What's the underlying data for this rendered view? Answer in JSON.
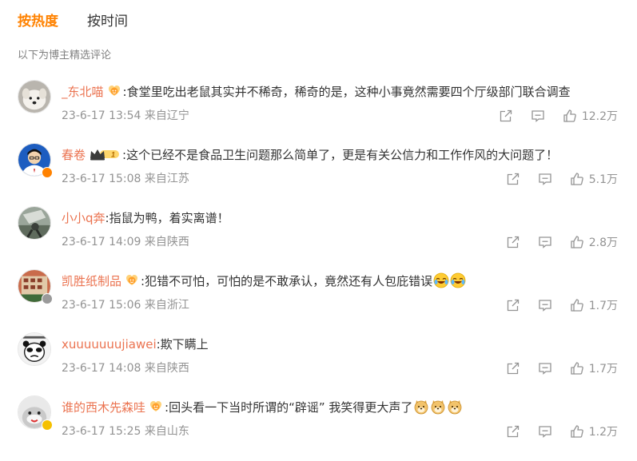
{
  "tabs": {
    "hot": "按热度",
    "time": "按时间"
  },
  "section_note": "以下为博主精选评论",
  "comments": [
    {
      "user": "_东北喵",
      "badge": "fan",
      "text": ":食堂里吃出老鼠其实并不稀奇，稀奇的是，这种小事竟然需要四个厅级部门联合调查",
      "time": "23-6-17 13:54",
      "location": "来自辽宁",
      "likes": "12.2万",
      "emojis": 0
    },
    {
      "user": "春卷",
      "badge": "crown",
      "badge_level": "1",
      "text": ":这个已经不是食品卫生问题那么简单了，更是有关公信力和工作作风的大问题了！",
      "time": "23-6-17 15:08",
      "location": "来自江苏",
      "likes": "5.1万",
      "emojis": 0,
      "verified_color": "#ff8200"
    },
    {
      "user": "小小q奔",
      "badge": "",
      "text": ":指鼠为鸭，着实离谱！",
      "time": "23-6-17 14:09",
      "location": "来自陕西",
      "likes": "2.8万",
      "emojis": 0
    },
    {
      "user": "凯胜纸制品",
      "badge": "fan",
      "text": ":犯错不可怕，可怕的是不敢承认，竟然还有人包庇错误",
      "time": "23-6-17 15:06",
      "location": "来自浙江",
      "likes": "1.7万",
      "emojis": 2,
      "emoji_icon": "laugh-cry-icon",
      "verified_color": "#9a9a9a"
    },
    {
      "user": "xuuuuuuujiawei",
      "badge": "",
      "text": ":欺下瞒上",
      "time": "23-6-17 14:08",
      "location": "来自陕西",
      "likes": "1.7万",
      "emojis": 0
    },
    {
      "user": "谁的西木先森哇",
      "badge": "fan",
      "text": ":回头看一下当时所谓的“辟谣” 我笑得更大声了",
      "time": "23-6-17 15:25",
      "location": "来自山东",
      "likes": "1.2万",
      "emojis": 3,
      "emoji_icon": "doge-icon",
      "verified_color": "#f5c000"
    }
  ],
  "colors": {
    "accent": "#ff8200",
    "username": "#eb7350",
    "meta": "#939393"
  },
  "icons": {
    "share": "share-icon",
    "comment": "comment-icon",
    "like": "thumbs-up-icon"
  }
}
